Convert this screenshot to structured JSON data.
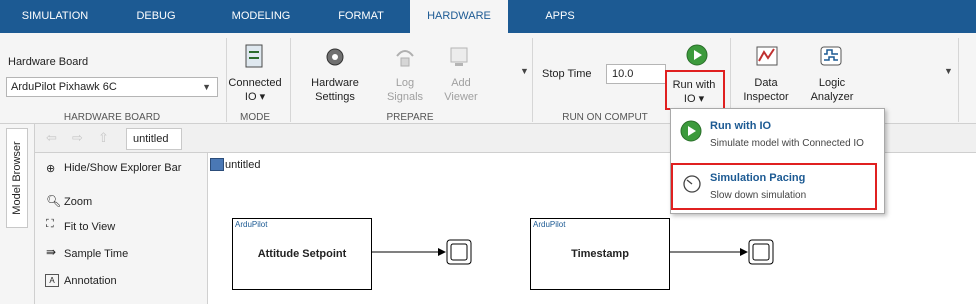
{
  "tabs": [
    "SIMULATION",
    "DEBUG",
    "MODELING",
    "FORMAT",
    "HARDWARE",
    "APPS"
  ],
  "ribbon": {
    "hardware_board_label": "Hardware Board",
    "hardware_board_value": "ArduPilot Pixhawk 6C",
    "connected_io": [
      "Connected",
      "IO"
    ],
    "hardware_settings": [
      "Hardware",
      "Settings"
    ],
    "log_signals": [
      "Log",
      "Signals"
    ],
    "add_viewer": [
      "Add",
      "Viewer"
    ],
    "stop_time_label": "Stop Time",
    "stop_time_value": "10.0",
    "run_with_io": [
      "Run with",
      "IO"
    ],
    "data_inspector": [
      "Data",
      "Inspector"
    ],
    "logic_analyzer": [
      "Logic",
      "Analyzer"
    ],
    "sections": {
      "hardware_board": "HARDWARE BOARD",
      "mode": "MODE",
      "prepare": "PREPARE",
      "run_on_computer": "RUN ON COMPUT"
    }
  },
  "left": {
    "model_browser": "Model Browser",
    "tab_title": "untitled",
    "palette": [
      {
        "label": "Hide/Show Explorer Bar",
        "icon": "explorer-icon"
      },
      {
        "label": "Zoom",
        "icon": "zoom-icon"
      },
      {
        "label": "Fit to View",
        "icon": "fit-icon"
      },
      {
        "label": "Sample Time",
        "icon": "arrow-icon"
      },
      {
        "label": "Annotation",
        "icon": "annotation-icon"
      }
    ]
  },
  "canvas": {
    "breadcrumb": "untitled",
    "blocks": [
      {
        "tag": "ArduPilot",
        "title": "Attitude Setpoint"
      },
      {
        "tag": "ArduPilot",
        "title": "Timestamp"
      }
    ]
  },
  "menu": {
    "items": [
      {
        "title": "Run with IO",
        "sub": "Simulate model with Connected IO"
      },
      {
        "title": "Simulation Pacing",
        "sub": "Slow down simulation"
      }
    ]
  },
  "accent_color": "#1c5a93",
  "highlight_color": "#e02020"
}
